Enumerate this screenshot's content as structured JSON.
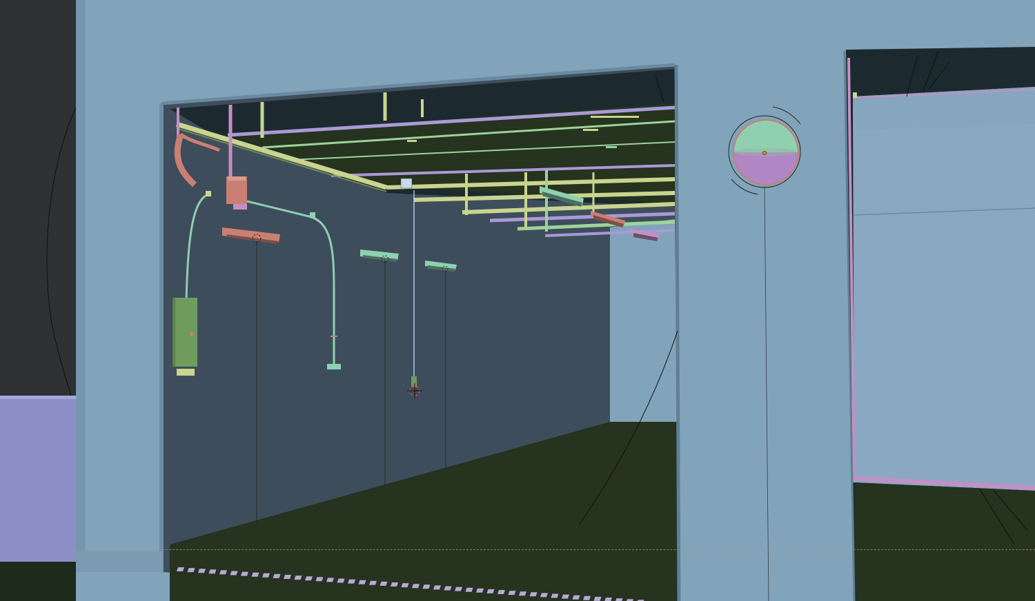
{
  "viewport": {
    "kind": "3d-viewport",
    "shading": "solid",
    "overlays": [
      "object-origins",
      "light-guides",
      "3d-cursor",
      "floor-line"
    ]
  },
  "palette": {
    "background": "#2f3133",
    "wall": "#82a4bb",
    "wall_shadow": "#5f7f94",
    "interior_wall": "#3f4e5c",
    "interior_wall_dark": "#35424e",
    "ceiling_void": "#1c2a30",
    "floor": "#25331f",
    "floor_dark": "#1e2b1a",
    "lavender_block": "#8b8fc6",
    "beam_yellow": "#c9d48e",
    "beam_green": "#9fd39a",
    "beam_pink": "#c58fc5",
    "beam_purple": "#a99ad6",
    "salmon": "#c97f72",
    "mint": "#8fd0b0",
    "panel_green": "#6f9b5d",
    "selected_orange": "#ff8a1a",
    "cursor_red": "#e0404a"
  },
  "objects": [
    {
      "name": "wall-front",
      "type": "mesh"
    },
    {
      "name": "doorway-main",
      "type": "mesh"
    },
    {
      "name": "doorway-right",
      "type": "mesh"
    },
    {
      "name": "ceiling-beams",
      "type": "mesh"
    },
    {
      "name": "light-fixture",
      "type": "light",
      "count": 6
    },
    {
      "name": "electrical-box",
      "type": "mesh"
    },
    {
      "name": "conduit",
      "type": "curve",
      "count": 2
    },
    {
      "name": "wall-panel",
      "type": "mesh"
    },
    {
      "name": "sphere",
      "type": "mesh",
      "selected": true
    },
    {
      "name": "floor-grate",
      "type": "mesh"
    },
    {
      "name": "3d-cursor",
      "type": "cursor"
    }
  ],
  "icons": {
    "cursor": "3d-cursor-icon",
    "origin": "object-origin-icon",
    "light": "light-icon"
  }
}
